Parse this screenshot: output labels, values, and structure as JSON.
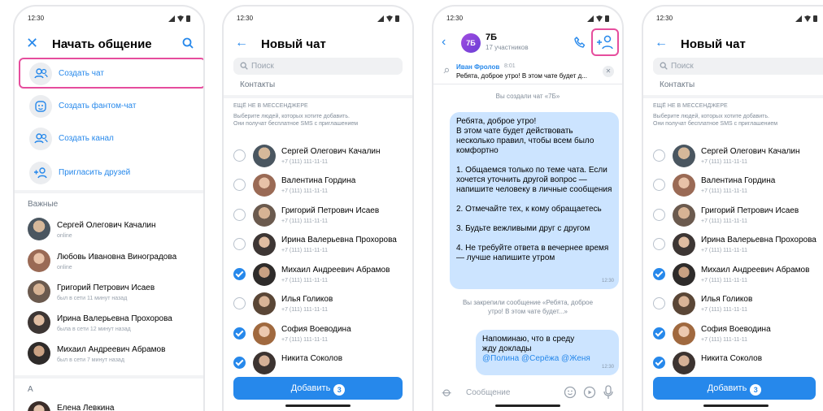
{
  "status_time": "12:30",
  "screen1": {
    "title": "Начать общение",
    "menu": [
      {
        "label": "Создать чат",
        "icon": "group-icon"
      },
      {
        "label": "Создать фантом-чат",
        "icon": "ghost-face-icon"
      },
      {
        "label": "Создать канал",
        "icon": "channel-icon"
      },
      {
        "label": "Пригласить друзей",
        "icon": "add-user-icon"
      }
    ],
    "important_header": "Важные",
    "contacts": [
      {
        "name": "Сергей Олегович Качалин",
        "status": "online"
      },
      {
        "name": "Любовь Ивановна Виноградова",
        "status": "online"
      },
      {
        "name": "Григорий Петрович Исаев",
        "status": "был в сети 11 минут назад"
      },
      {
        "name": "Ирина Валерьевна Прохорова",
        "status": "была в сети 12 минут назад"
      },
      {
        "name": "Михаил Андреевич Абрамов",
        "status": "был в сети 7 минут назад"
      }
    ],
    "letter_header": "А",
    "next_contact": "Елена Левкина"
  },
  "newchat": {
    "title": "Новый чат",
    "search_placeholder": "Поиск",
    "contacts_label": "Контакты",
    "not_in_header": "ЕЩЁ НЕ В МЕССЕНДЖЕРЕ",
    "not_in_caption_1": "Выберите людей, которых хотите добавить.",
    "not_in_caption_2": "Они получат бесплатное  SMS с приглашением",
    "people": [
      {
        "name": "Сергей Олегович Качалин",
        "phone": "+7 (111) 111-11-11",
        "checked": false
      },
      {
        "name": "Валентина Гордина",
        "phone": "+7 (111) 111-11-11",
        "checked": false
      },
      {
        "name": "Григорий Петрович Исаев",
        "phone": "+7 (111) 111-11-11",
        "checked": false
      },
      {
        "name": "Ирина Валерьевна Прохорова",
        "phone": "+7 (111) 111-11-11",
        "checked": false
      },
      {
        "name": "Михаил  Андреевич Абрамов",
        "phone": "+7 (111) 111-11-11",
        "checked": true
      },
      {
        "name": "Илья Голиков",
        "phone": "+7 (111) 111-11-11",
        "checked": false
      },
      {
        "name": "София Воеводина",
        "phone": "+7 (111) 111-11-11",
        "checked": true
      },
      {
        "name": "Никита Соколов",
        "phone": "+7 (111) 111-11-11",
        "checked": true
      }
    ],
    "add_label": "Добавить",
    "add_count": "3"
  },
  "chat": {
    "avatar_text": "7Б",
    "name": "7Б",
    "members": "17 участников",
    "pinned_author": "Иван Фролов",
    "pinned_time": "8:01",
    "pinned_text": "Ребята, доброе утро! В этом чате будет д...",
    "created_msg": "Вы создали чат «7Б»",
    "msg1": "Ребята, доброе утро!\nВ этом чате будет действовать несколько правил, чтобы всем было комфортно\n\n1. Общаемся только по теме чата. Если хочется уточнить другой вопрос — напишите человеку в личные сообщения\n\n2. Отмечайте тех, к кому обращаетесь\n\n3. Будьте вежливыми друг с другом\n\n4. Не требуйте ответа в вечернее время — лучше напишите утром",
    "msg1_time": "12:30",
    "pinned_sys_1": "Вы закрепили сообщение «Ребята, доброе",
    "pinned_sys_2": "утро! В этом чате будет...»",
    "msg2_text": "Напоминаю, что в среду\nжду доклады",
    "msg2_mentions": "@Полина @Серёжа @Женя",
    "msg2_time": "12:30",
    "composer_placeholder": "Сообщение"
  },
  "colors": {
    "accent": "#2688eb",
    "highlight": "#e64d9d",
    "bubble": "#cce4ff"
  }
}
